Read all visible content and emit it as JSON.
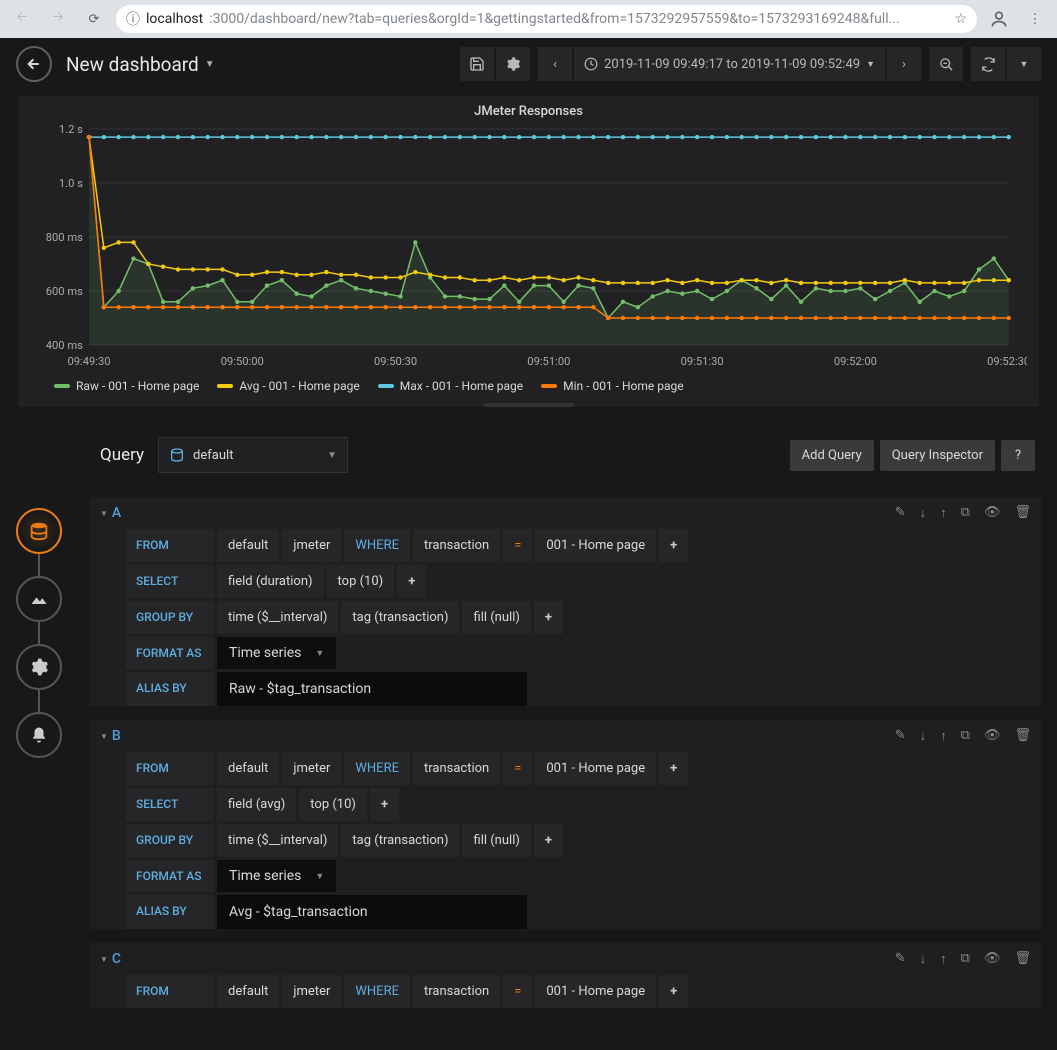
{
  "browser": {
    "url_host": "localhost",
    "url_path": ":3000/dashboard/new?tab=queries&orgId=1&gettingstarted&from=1573292957559&to=1573293169248&full..."
  },
  "header": {
    "title": "New dashboard",
    "time_range": "2019-11-09 09:49:17 to 2019-11-09 09:52:49"
  },
  "panel": {
    "title": "JMeter Responses"
  },
  "chart_data": {
    "type": "line",
    "title": "JMeter Responses",
    "xlabel": "",
    "ylabel": "",
    "ylim": [
      400,
      1200
    ],
    "y_ticks": [
      {
        "v": 400,
        "l": "400 ms"
      },
      {
        "v": 600,
        "l": "600 ms"
      },
      {
        "v": 800,
        "l": "800 ms"
      },
      {
        "v": 1000,
        "l": "1.0 s"
      },
      {
        "v": 1200,
        "l": "1.2 s"
      }
    ],
    "x_ticks": [
      "09:49:30",
      "09:50:00",
      "09:50:30",
      "09:51:00",
      "09:51:30",
      "09:52:00",
      "09:52:30"
    ],
    "x": [
      0,
      1,
      2,
      3,
      4,
      5,
      6,
      7,
      8,
      9,
      10,
      11,
      12,
      13,
      14,
      15,
      16,
      17,
      18,
      19,
      20,
      21,
      22,
      23,
      24,
      25,
      26,
      27,
      28,
      29,
      30,
      31,
      32,
      33,
      34,
      35,
      36,
      37,
      38,
      39,
      40,
      41,
      42,
      43,
      44,
      45,
      46,
      47,
      48,
      49,
      50,
      51,
      52,
      53,
      54,
      55,
      56,
      57,
      58,
      59,
      60,
      61,
      62
    ],
    "series": [
      {
        "name": "Raw - 001 - Home page",
        "color": "#73bf69",
        "values": [
          1170,
          540,
          600,
          720,
          700,
          560,
          560,
          610,
          620,
          640,
          560,
          560,
          620,
          640,
          590,
          580,
          620,
          640,
          610,
          600,
          590,
          580,
          780,
          650,
          580,
          580,
          570,
          570,
          620,
          560,
          620,
          620,
          560,
          620,
          610,
          500,
          560,
          540,
          580,
          600,
          590,
          600,
          570,
          600,
          640,
          610,
          570,
          620,
          560,
          610,
          600,
          600,
          610,
          570,
          600,
          630,
          560,
          600,
          580,
          600,
          680,
          720,
          640
        ]
      },
      {
        "name": "Avg - 001 - Home page",
        "color": "#f2cc0c",
        "values": [
          1170,
          760,
          780,
          780,
          700,
          690,
          680,
          680,
          680,
          680,
          660,
          660,
          670,
          670,
          660,
          660,
          670,
          660,
          660,
          650,
          650,
          650,
          670,
          660,
          650,
          650,
          640,
          640,
          650,
          640,
          650,
          650,
          640,
          650,
          640,
          630,
          630,
          630,
          630,
          640,
          630,
          640,
          630,
          630,
          640,
          640,
          630,
          640,
          630,
          630,
          630,
          630,
          630,
          630,
          630,
          640,
          630,
          630,
          630,
          630,
          640,
          640,
          640
        ]
      },
      {
        "name": "Max - 001 - Home page",
        "color": "#5ec8e0",
        "values": [
          1170,
          1170,
          1170,
          1170,
          1170,
          1170,
          1170,
          1170,
          1170,
          1170,
          1170,
          1170,
          1170,
          1170,
          1170,
          1170,
          1170,
          1170,
          1170,
          1170,
          1170,
          1170,
          1170,
          1170,
          1170,
          1170,
          1170,
          1170,
          1170,
          1170,
          1170,
          1170,
          1170,
          1170,
          1170,
          1170,
          1170,
          1170,
          1170,
          1170,
          1170,
          1170,
          1170,
          1170,
          1170,
          1170,
          1170,
          1170,
          1170,
          1170,
          1170,
          1170,
          1170,
          1170,
          1170,
          1170,
          1170,
          1170,
          1170,
          1170,
          1170,
          1170,
          1170
        ]
      },
      {
        "name": "Min - 001 - Home page",
        "color": "#ff780a",
        "values": [
          1170,
          540,
          540,
          540,
          540,
          540,
          540,
          540,
          540,
          540,
          540,
          540,
          540,
          540,
          540,
          540,
          540,
          540,
          540,
          540,
          540,
          540,
          540,
          540,
          540,
          540,
          540,
          540,
          540,
          540,
          540,
          540,
          540,
          540,
          540,
          500,
          500,
          500,
          500,
          500,
          500,
          500,
          500,
          500,
          500,
          500,
          500,
          500,
          500,
          500,
          500,
          500,
          500,
          500,
          500,
          500,
          500,
          500,
          500,
          500,
          500,
          500,
          500
        ]
      }
    ]
  },
  "query_section": {
    "label": "Query",
    "datasource": "default",
    "add_query": "Add Query",
    "inspector": "Query Inspector",
    "help": "?"
  },
  "queries": [
    {
      "letter": "A",
      "from_default": "default",
      "from_measurement": "jmeter",
      "where": "WHERE",
      "tag_key": "transaction",
      "op": "=",
      "tag_val": "001 - Home page",
      "select_field": "field (duration)",
      "select_agg": "top (10)",
      "group_time": "time (",
      "group_interval": "$__interval",
      "group_time_close": ")",
      "group_tag": "tag (transaction)",
      "group_fill": "fill (null)",
      "format": "Time series",
      "alias": "Raw - $tag_transaction"
    },
    {
      "letter": "B",
      "from_default": "default",
      "from_measurement": "jmeter",
      "where": "WHERE",
      "tag_key": "transaction",
      "op": "=",
      "tag_val": "001 - Home page",
      "select_field": "field (avg)",
      "select_agg": "top (10)",
      "group_time": "time (",
      "group_interval": "$__interval",
      "group_time_close": ")",
      "group_tag": "tag (transaction)",
      "group_fill": "fill (null)",
      "format": "Time series",
      "alias": "Avg - $tag_transaction"
    },
    {
      "letter": "C",
      "from_default": "default",
      "from_measurement": "jmeter",
      "where": "WHERE",
      "tag_key": "transaction",
      "op": "=",
      "tag_val": "001 - Home page"
    }
  ],
  "labels": {
    "from": "FROM",
    "select": "SELECT",
    "group": "GROUP BY",
    "format": "FORMAT AS",
    "alias": "ALIAS BY"
  }
}
